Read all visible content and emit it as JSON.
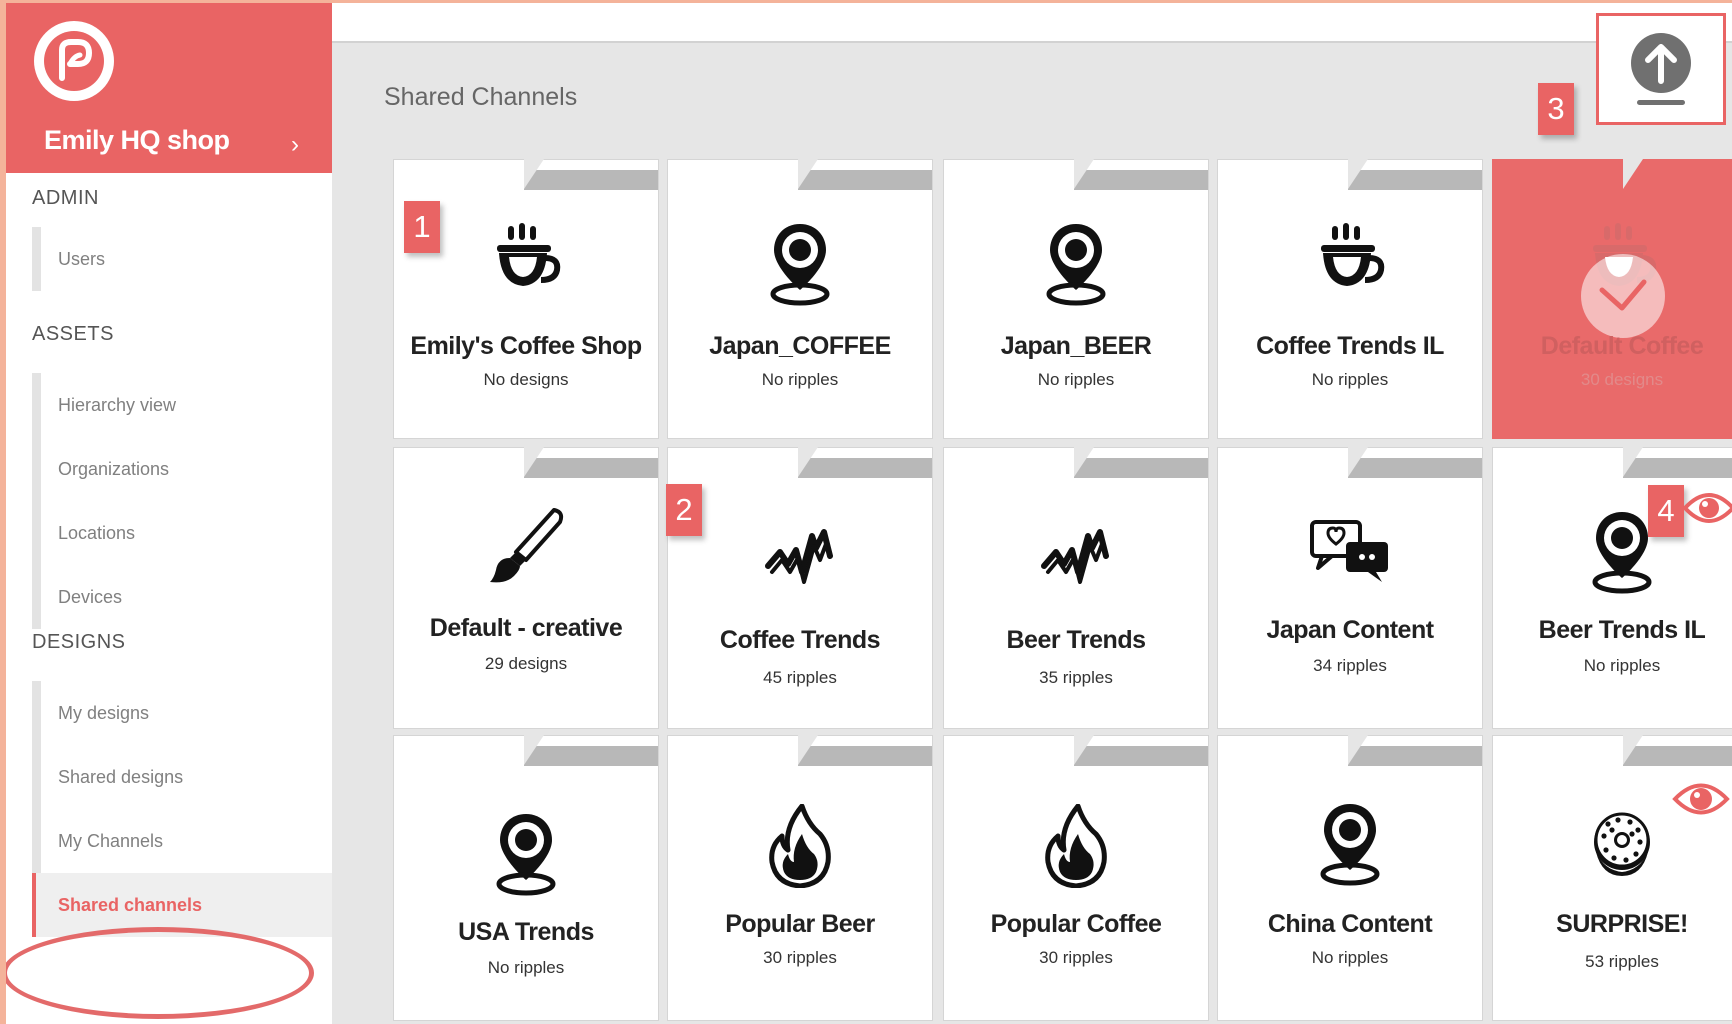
{
  "sidebar": {
    "shop_name": "Emily HQ shop",
    "shop_chevron": "›",
    "sections": {
      "admin": "ADMIN",
      "assets": "ASSETS",
      "designs": "DESIGNS"
    },
    "items": {
      "users": "Users",
      "hierarchy_view": "Hierarchy view",
      "organizations": "Organizations",
      "locations": "Locations",
      "devices": "Devices",
      "my_designs": "My designs",
      "shared_designs": "Shared designs",
      "my_channels": "My Channels",
      "shared_channels": "Shared channels"
    },
    "active_item": "Shared channels"
  },
  "main": {
    "title": "Shared Channels",
    "upload_icon": "upload-arrow-icon",
    "cards": [
      {
        "title": "Emily's Coffee Shop",
        "sub": "No designs",
        "icon": "coffee-cup-icon"
      },
      {
        "title": "Japan_COFFEE",
        "sub": "No ripples",
        "icon": "location-pin-icon"
      },
      {
        "title": "Japan_BEER",
        "sub": "No ripples",
        "icon": "location-pin-icon"
      },
      {
        "title": "Coffee Trends IL",
        "sub": "No ripples",
        "icon": "coffee-cup-icon"
      },
      {
        "title": "Default Coffee",
        "sub": "30 designs",
        "icon": "coffee-cup-icon",
        "selected": true
      },
      {
        "title": "Default - creative",
        "sub": "29 designs",
        "icon": "paintbrush-icon"
      },
      {
        "title": "Coffee Trends",
        "sub": "45 ripples",
        "icon": "trend-wave-icon"
      },
      {
        "title": "Beer Trends",
        "sub": "35 ripples",
        "icon": "trend-wave-icon"
      },
      {
        "title": "Japan Content",
        "sub": "34 ripples",
        "icon": "chat-bubbles-icon"
      },
      {
        "title": "Beer Trends IL",
        "sub": "No ripples",
        "icon": "location-pin-icon"
      },
      {
        "title": "USA Trends",
        "sub": "No ripples",
        "icon": "location-pin-icon"
      },
      {
        "title": "Popular Beer",
        "sub": "30 ripples",
        "icon": "flame-icon"
      },
      {
        "title": "Popular Coffee",
        "sub": "30 ripples",
        "icon": "flame-icon"
      },
      {
        "title": "China Content",
        "sub": "No ripples",
        "icon": "location-pin-icon"
      },
      {
        "title": "SURPRISE!",
        "sub": "53 ripples",
        "icon": "donut-icon"
      }
    ]
  },
  "annotations": {
    "badge1": "1",
    "badge2": "2",
    "badge3": "3",
    "badge4": "4"
  },
  "colors": {
    "brand": "#e96464",
    "background": "#e6e6e6",
    "outer_frame": "#f4b39a"
  }
}
